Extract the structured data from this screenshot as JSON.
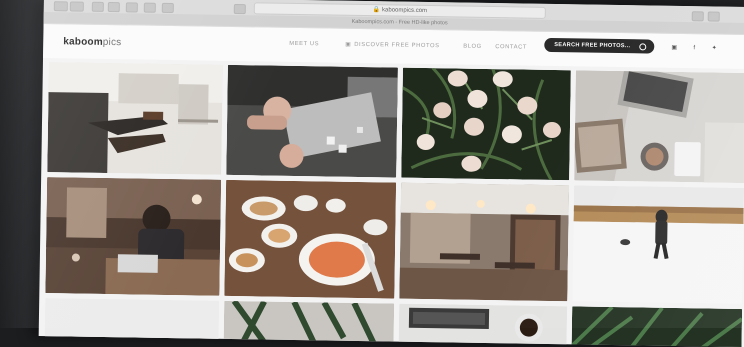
{
  "browser": {
    "url": "kaboompics.com",
    "tab_title": "Kaboompics.com - Free HD-like photos"
  },
  "site": {
    "logo_bold": "kaboom",
    "logo_light": "pics",
    "nav": {
      "meet_us": "MEET US",
      "discover": "DISCOVER FREE PHOTOS",
      "blog": "BLOG",
      "contact": "CONTACT"
    },
    "search_label": "SEARCH FREE PHOTOS...",
    "social": [
      "instagram-icon",
      "facebook-icon",
      "twitter-icon"
    ]
  },
  "photos": [
    {
      "subject": "person relaxing on sofa in living room"
    },
    {
      "subject": "hands playing board game"
    },
    {
      "subject": "easter eggs on greenery"
    },
    {
      "subject": "laptop and notebook on desk"
    },
    {
      "subject": "man working on laptop in cafe"
    },
    {
      "subject": "food dishes on wooden table"
    },
    {
      "subject": "cafe interior"
    },
    {
      "subject": "person walking dog in snow"
    },
    {
      "subject": "plant leaves"
    },
    {
      "subject": "plant leaves on table"
    },
    {
      "subject": "laptop keyboard and coffee"
    },
    {
      "subject": "palm leaves"
    }
  ]
}
